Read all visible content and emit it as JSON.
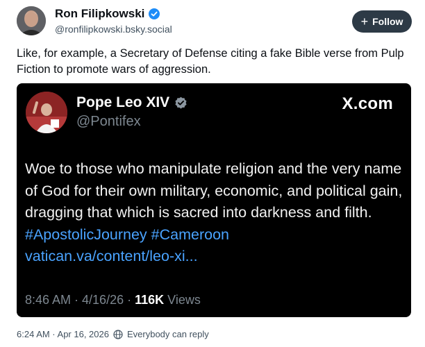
{
  "post": {
    "author_name": "Ron Filipkowski",
    "author_handle": "@ronfilipkowski.bsky.social",
    "follow_label": "Follow",
    "text": "Like, for example, a Secretary of Defense citing a fake Bible verse from Pulp Fiction to promote wars of aggression.",
    "timestamp": "6:24 AM · Apr 16, 2026",
    "reply_setting": "Everybody can reply"
  },
  "embed": {
    "author_name": "Pope Leo XIV",
    "author_handle": "@Pontifex",
    "site": "X.com",
    "body_text": "Woe to those who manipulate religion and the very name of God for their own military, economic, and political gain, dragging that which is sacred into darkness and filth. ",
    "hashtag1": "#ApostolicJourney",
    "hashtag2": "#Cameroon",
    "link": "vatican.va/content/leo-xi...",
    "time": "8:46 AM · 4/16/26 · ",
    "views_count": "116K",
    "views_label": " Views"
  },
  "colors": {
    "follow_bg": "#2d3a46",
    "embed_bg": "#000000",
    "link": "#4aa3ff",
    "verified": "#1d8cf8"
  },
  "icons": [
    "verified-badge-icon",
    "plus-icon",
    "globe-icon"
  ]
}
